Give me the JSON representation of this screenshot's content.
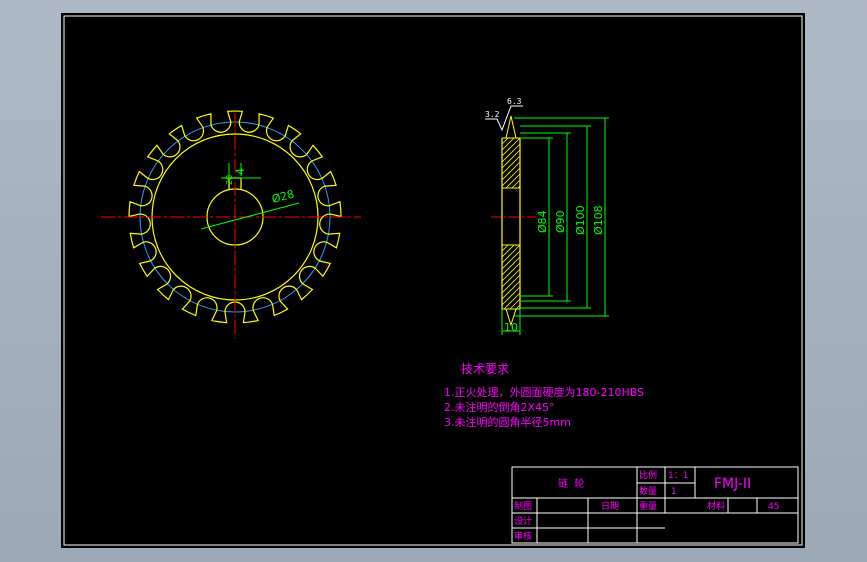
{
  "drawing": {
    "title_block": {
      "part_name": "链  轮",
      "scale_label": "比例",
      "scale_value": "1：1",
      "quantity_label": "数量",
      "quantity_value": "1",
      "drawing_code": "FMJ-II",
      "drawn_by_label": "制图",
      "date_label": "日期",
      "weight_label": "重量",
      "material_label": "材料",
      "material_value": "45",
      "design_label": "设计",
      "review_label": "审核"
    },
    "tech_requirements": {
      "heading": "技术要求",
      "items": [
        "1.正火处理，外圆面硬度为180-210HBS",
        "2.未注明的倒角2X45°",
        "3.未注明的圆角半径5mm"
      ]
    },
    "dimensions": {
      "keyway_width": "4",
      "keyway_depth": "28",
      "bore": "Ø28",
      "roughness_top": "6.3",
      "roughness_side": "3.2",
      "d84": "Ø84",
      "d90": "Ø90",
      "d100": "Ø100",
      "d108": "Ø108",
      "thickness": "10"
    },
    "colors": {
      "background": "#000000",
      "outline": "#ffff00",
      "dimension": "#00ff00",
      "center_line": "#ff0000",
      "pitch_circle": "#3399ff",
      "text": "#ff00ff",
      "frame": "#ffffff"
    }
  }
}
